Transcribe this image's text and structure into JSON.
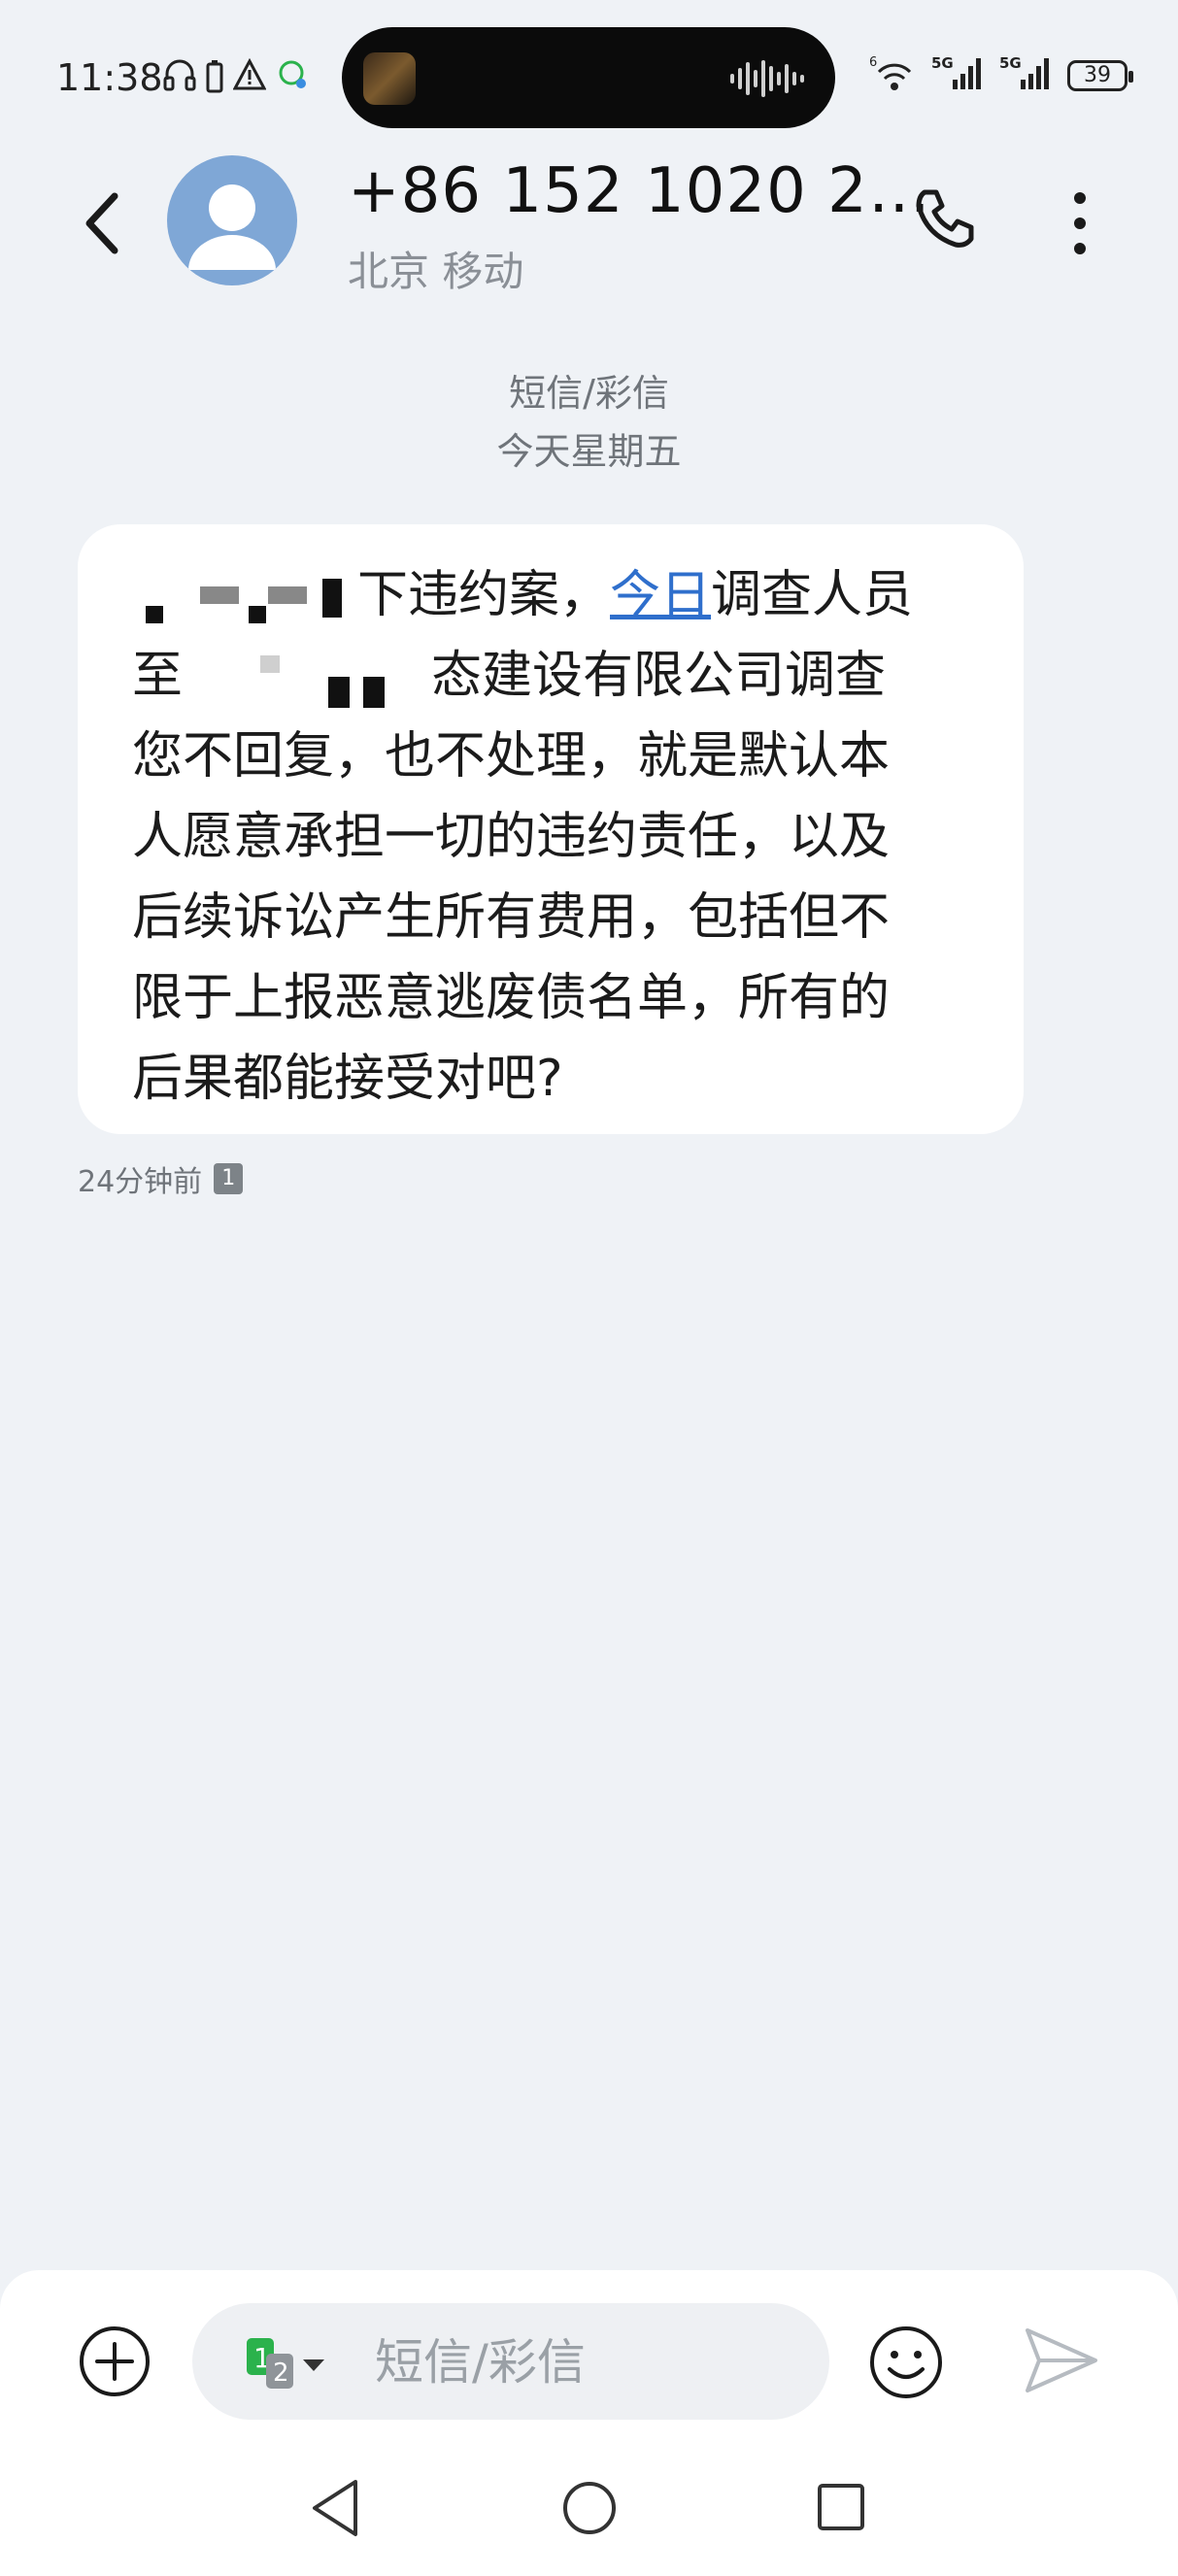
{
  "status_bar": {
    "time": "11:38",
    "battery": "39",
    "network_1": "5G",
    "network_2": "5G",
    "wifi_label": "6"
  },
  "header": {
    "contact_name": "+86 152 1020 2…",
    "contact_location": "北京 移动",
    "icons": [
      "back-icon",
      "avatar-person-icon",
      "phone-icon",
      "more-vertical-icon"
    ]
  },
  "thread": {
    "message_type": "短信/彩信",
    "date_label": "今天星期五",
    "message": {
      "line1_suffix": "下违约案，",
      "line1_link": "今日",
      "line1_after": "调查人员",
      "line2_prefix": "至",
      "line2_suffix": "态建设有限公司调查",
      "line3": "您不回复，也不处理，就是默认本",
      "line4": "人愿意承担一切的违约责任，以及",
      "line5": "后续诉讼产生所有费用，包括但不",
      "line6": "限于上报恶意逃废债名单，所有的",
      "line7": "后果都能接受对吧?",
      "time_ago": "24分钟前",
      "sim_slot": "1"
    }
  },
  "composer": {
    "placeholder": "短信/彩信",
    "sim_primary": "1",
    "sim_secondary": "2"
  },
  "colors": {
    "background": "#eff2f6",
    "bubble": "#ffffff",
    "link": "#2f6fcc",
    "avatar": "#7fa7d6",
    "sim_green": "#2bb24c"
  }
}
